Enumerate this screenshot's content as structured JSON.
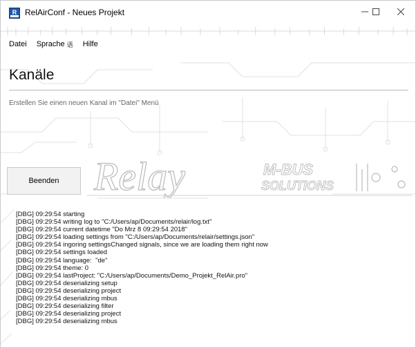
{
  "window": {
    "title": "RelAirConf - Neues Projekt",
    "controls": {
      "minimize": "minimize",
      "maximize": "maximize",
      "close": "close"
    }
  },
  "menu": {
    "items": [
      {
        "label": "Datei"
      },
      {
        "label": "Sprache",
        "icon": "language-icon",
        "icon_glyph": "语"
      },
      {
        "label": "Hilfe"
      }
    ]
  },
  "main": {
    "heading": "Kanäle",
    "hint": "Erstellen Sie einen neuen Kanal im \"Datei\" Menü",
    "quit_button": "Beenden"
  },
  "logo": {
    "brand": "Relay",
    "sub1": "M-BUS",
    "sub2": "SOLUTIONS"
  },
  "log": [
    "[DBG] 09:29:54 starting",
    "[DBG] 09:29:54 writing log to \"C:/Users/ap/Documents/relair/log.txt\"",
    "[DBG] 09:29:54 current datetime \"Do Mrz 8 09:29:54 2018\"",
    "[DBG] 09:29:54 loading settings from \"C:/Users/ap/Documents/relair/settings.json\"",
    "[DBG] 09:29:54 ingoring settingsChanged signals, since we are loading them right now",
    "[DBG] 09:29:54 settings loaded",
    "[DBG] 09:29:54 language:  \"de\"",
    "[DBG] 09:29:54 theme: 0",
    "[DBG] 09:29:54 lastProject: \"C:/Users/ap/Documents/Demo_Projekt_RelAir.pro\"",
    "[DBG] 09:29:54 deserializing setup",
    "[DBG] 09:29:54 deserializing project",
    "[DBG] 09:29:54 deserializing mbus",
    "[DBG] 09:29:54 deserializing filter",
    "[DBG] 09:29:54 deserializing project",
    "[DBG] 09:29:54 deserializing mbus"
  ],
  "colors": {
    "app_icon": "#1f5aa6",
    "circuit": "#d6d6d6",
    "logo_stroke": "#b4b4b4"
  }
}
